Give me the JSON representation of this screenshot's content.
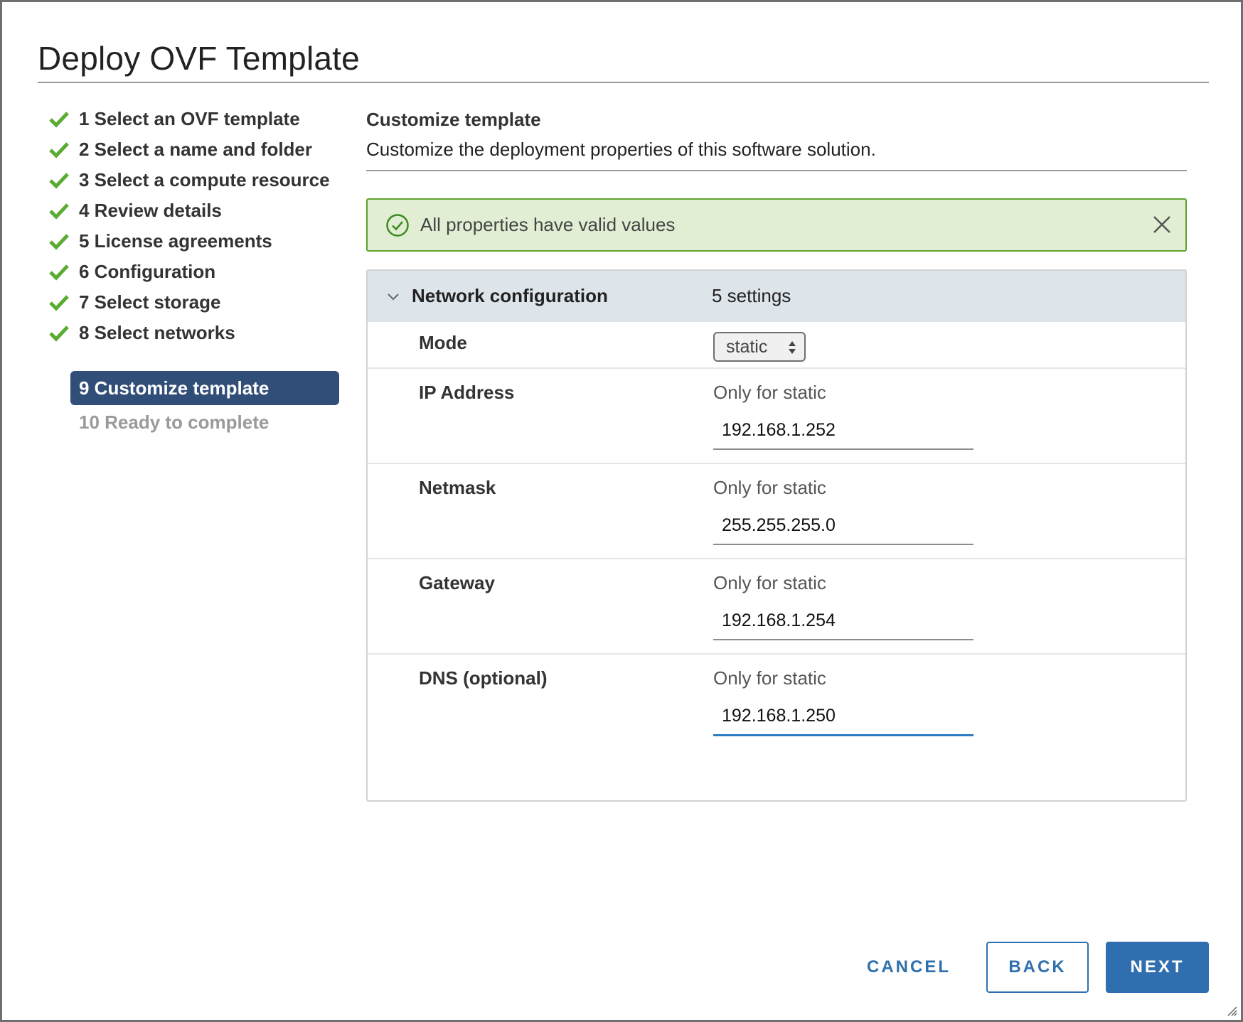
{
  "dialog": {
    "title": "Deploy OVF Template"
  },
  "steps": [
    {
      "label": "1 Select an OVF template",
      "state": "done"
    },
    {
      "label": "2 Select a name and folder",
      "state": "done"
    },
    {
      "label": "3 Select a compute resource",
      "state": "done"
    },
    {
      "label": "4 Review details",
      "state": "done"
    },
    {
      "label": "5 License agreements",
      "state": "done"
    },
    {
      "label": "6 Configuration",
      "state": "done"
    },
    {
      "label": "7 Select storage",
      "state": "done"
    },
    {
      "label": "8 Select networks",
      "state": "done"
    },
    {
      "label": "9 Customize template",
      "state": "current"
    },
    {
      "label": "10 Ready to complete",
      "state": "disabled"
    }
  ],
  "content": {
    "heading": "Customize template",
    "description": "Customize the deployment properties of this software solution."
  },
  "alert": {
    "message": "All properties have valid values"
  },
  "section": {
    "name": "Network configuration",
    "count": "5 settings",
    "mode": {
      "label": "Mode",
      "value": "static"
    },
    "fields": [
      {
        "label": "IP Address",
        "hint": "Only for static",
        "value": "192.168.1.252"
      },
      {
        "label": "Netmask",
        "hint": "Only for static",
        "value": "255.255.255.0"
      },
      {
        "label": "Gateway",
        "hint": "Only for static",
        "value": "192.168.1.254"
      },
      {
        "label": "DNS (optional)",
        "hint": "Only for static",
        "value": "192.168.1.250"
      }
    ]
  },
  "buttons": {
    "cancel": "CANCEL",
    "back": "BACK",
    "next": "NEXT"
  },
  "colors": {
    "accent": "#2f6fb0",
    "current_step": "#314e78",
    "success": "#5fa22d",
    "success_bg": "#e1eed4"
  }
}
